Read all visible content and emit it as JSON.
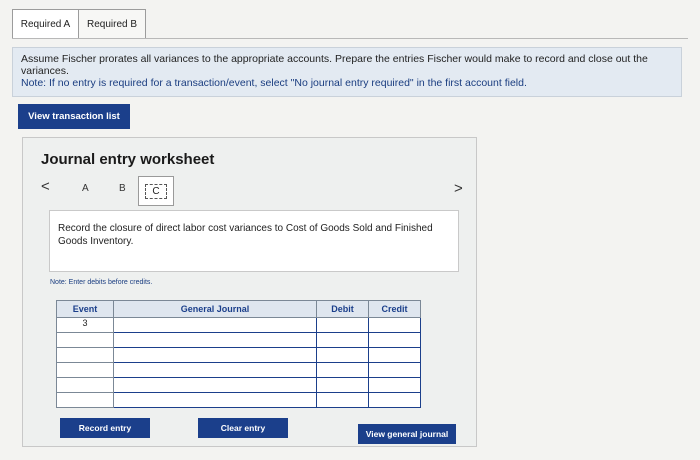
{
  "tabs": [
    {
      "label": "Required A"
    },
    {
      "label": "Required B"
    }
  ],
  "instructions": {
    "line1": "Assume Fischer prorates all variances to the appropriate accounts. Prepare the entries Fischer would make to record and close out the variances.",
    "note": "Note: If no entry is required for a transaction/event, select \"No journal entry required\" in the first account field."
  },
  "view_transactions_label": "View transaction list",
  "worksheet": {
    "title": "Journal entry worksheet",
    "nav": {
      "prev": "<",
      "a": "A",
      "b": "B",
      "c": "C",
      "next": ">"
    },
    "description": "Record the closure of direct labor cost variances to Cost of Goods Sold and Finished Goods Inventory.",
    "note": "Note: Enter debits before credits.",
    "table": {
      "headers": [
        "Event",
        "General Journal",
        "Debit",
        "Credit"
      ],
      "rows": [
        {
          "event": "3"
        },
        {
          "event": ""
        },
        {
          "event": ""
        },
        {
          "event": ""
        },
        {
          "event": ""
        },
        {
          "event": ""
        }
      ]
    },
    "buttons": {
      "record": "Record entry",
      "clear": "Clear entry",
      "view_journal": "View general journal"
    }
  }
}
